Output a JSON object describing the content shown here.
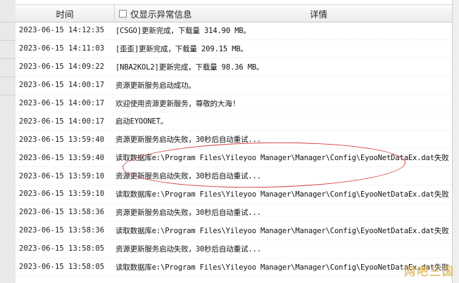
{
  "header": {
    "time_label": "时间",
    "filter_label": "仅显示异常信息",
    "detail_label": "详情"
  },
  "log_rows": [
    {
      "time": "2023-06-15 14:12:35",
      "detail": "[CSGO]更新完成，下载量 314.90 MB。"
    },
    {
      "time": "2023-06-15 14:11:03",
      "detail": "[歪歪]更新完成，下载量 209.15 MB。"
    },
    {
      "time": "2023-06-15 14:09:22",
      "detail": "[NBA2KOL2]更新完成，下载量 98.36 MB。"
    },
    {
      "time": "2023-06-15 14:00:17",
      "detail": "资源更新服务启动成功。"
    },
    {
      "time": "2023-06-15 14:00:17",
      "detail": "欢迎使用资源更新服务，尊敬的大海!"
    },
    {
      "time": "2023-06-15 14:00:17",
      "detail": "启动EYOONET。"
    },
    {
      "time": "2023-06-15 13:59:40",
      "detail": "资源更新服务启动失败，30秒后自动重试..."
    },
    {
      "time": "2023-06-15 13:59:40",
      "detail": "读取数据库e:\\Program Files\\Yileyoo Manager\\Manager\\Config\\EyooNetDataEx.dat失败"
    },
    {
      "time": "2023-06-15 13:59:10",
      "detail": "资源更新服务启动失败，30秒后自动重试..."
    },
    {
      "time": "2023-06-15 13:59:10",
      "detail": "读取数据库e:\\Program Files\\Yileyoo Manager\\Manager\\Config\\EyooNetDataEx.dat失败"
    },
    {
      "time": "2023-06-15 13:58:36",
      "detail": "资源更新服务启动失败，30秒后自动重试..."
    },
    {
      "time": "2023-06-15 13:58:36",
      "detail": "读取数据库e:\\Program Files\\Yileyoo Manager\\Manager\\Config\\EyooNetDataEx.dat失败"
    },
    {
      "time": "2023-06-15 13:58:05",
      "detail": "资源更新服务启动失败，30秒后自动重试..."
    },
    {
      "time": "2023-06-15 13:58:05",
      "detail": "读取数据库e:\\Program Files\\Yileyoo Manager\\Manager\\Config\\EyooNetDataEx.dat失败"
    }
  ],
  "annotation": {
    "color": "#d64040",
    "target_rows": [
      7,
      8
    ]
  },
  "watermark_text": "网吧三国"
}
